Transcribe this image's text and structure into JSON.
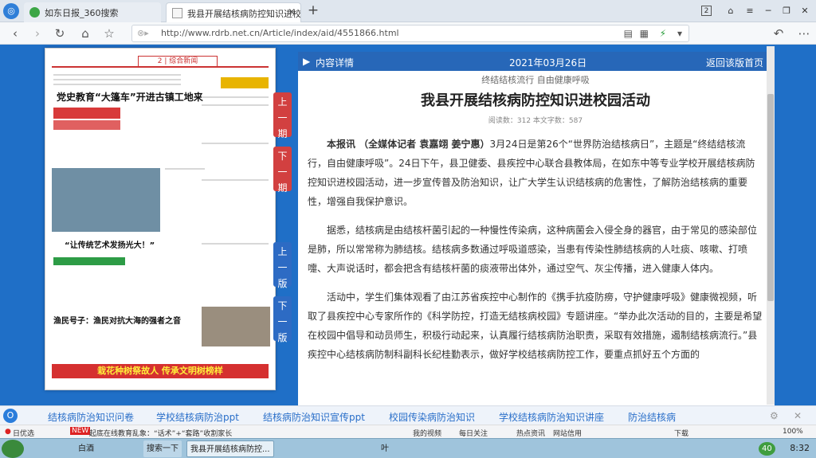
{
  "tabs": [
    {
      "label": "如东日报_360搜索"
    },
    {
      "label": "我县开展结核病防控知识进校园"
    }
  ],
  "window": {
    "tab_count": "2"
  },
  "toolbar": {
    "url": "http://www.rdrb.net.cn/Article/index/aid/4551866.html"
  },
  "side_nav": {
    "prev_issue": "上一期",
    "next_issue": "下一期",
    "prev_page": "上一版",
    "next_page": "下一版"
  },
  "paper": {
    "page_badge": "2",
    "section": "综合新闻",
    "headline1": "党史教育“大篷车”开进古镇工地来",
    "headline2": "“让传统艺术发扬光大！”",
    "headline3": "渔民号子：渔民对抗大海的强者之音",
    "banner": "栽花种树祭故人  传承文明树榜样"
  },
  "article": {
    "header_left": "内容详情",
    "date": "2021年03月26日",
    "back": "返回该版首页",
    "subtitle": "终结结核流行  自由健康呼吸",
    "title": "我县开展结核病防控知识进校园活动",
    "meta": "阅读数：312        本文字数：587",
    "p1_lead": "本报讯 （全媒体记者 袁嘉翊 姜宁惠）",
    "p1": "3月24日是第26个“世界防治结核病日”，主题是“终结结核流行，自由健康呼吸”。24日下午，县卫健委、县疾控中心联合县教体局，在如东中等专业学校开展结核病防控知识进校园活动，进一步宣传普及防治知识，让广大学生认识结核病的危害性，了解防治结核病的重要性，增强自我保护意识。",
    "p2": "据悉，结核病是由结核杆菌引起的一种慢性传染病，这种病菌会入侵全身的器官，由于常见的感染部位是肺，所以常常称为肺结核。结核病多数通过呼吸道感染，当患有传染性肺结核病的人吐痰、咳嗽、打喷嚏、大声说话时，都会把含有结核杆菌的痰液带出体外，通过空气、灰尘传播，进入健康人体内。",
    "p3": "活动中，学生们集体观看了由江苏省疾控中心制作的《携手抗疫防痨，守护健康呼吸》健康微视频，听取了县疾控中心专家所作的《科学防控，打造无结核病校园》专题讲座。“举办此次活动的目的，主要是希望在校园中倡导和动员师生，积极行动起来，认真履行结核病防治职责，采取有效措施，遏制结核病流行。”县疾控中心结核病防制科副科长纪桂勤表示，做好学校结核病防控工作，要重点抓好五个方面的"
  },
  "related": [
    "结核病防治知识问卷",
    "学校结核病防治ppt",
    "结核病防治知识宣传ppt",
    "校园传染病防治知识",
    "学校结核病防治知识讲座",
    "防治结核病"
  ],
  "status": {
    "left": "日优选",
    "new_badge": "NEW",
    "news": "起底在线教育乱象：“话术”+“套路”收割家长",
    "video": "我的视频",
    "daily": "每日关注",
    "hot": "热点资讯",
    "net": "网站信用",
    "download": "下载",
    "zoom": "100%"
  },
  "taskbar": {
    "items": [
      "白酒",
      "搜索一下",
      "我县开展结核病防控...",
      "叶"
    ],
    "clock": "8:32",
    "badge": "40"
  }
}
